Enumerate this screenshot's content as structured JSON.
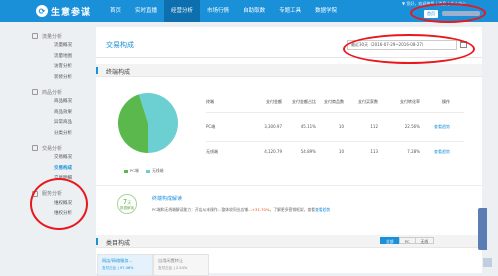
{
  "app": {
    "logo_text": "生意参谋"
  },
  "nav": [
    {
      "label": "首页",
      "active": false
    },
    {
      "label": "实时直播",
      "active": false
    },
    {
      "label": "经营分析",
      "active": true
    },
    {
      "label": "市场行情",
      "active": false
    },
    {
      "label": "自助取数",
      "active": false
    },
    {
      "label": "专题工具",
      "active": false
    },
    {
      "label": "数据学院",
      "active": false
    }
  ],
  "user_bar": {
    "text": "▼ 您好，欢迎使用  |  消息  |  个人中心"
  },
  "shop_button": "首页",
  "sidebar": {
    "sections": [
      {
        "title": "流量分析",
        "items": [
          "流量概况",
          "流量地图",
          "访客分析",
          "装修分析"
        ]
      },
      {
        "title": "商品分析",
        "items": [
          "商品概况",
          "商品效果",
          "异常商品",
          "分类分析"
        ]
      },
      {
        "title": "交易分析",
        "items": [
          "交易概况",
          "交易构成",
          "交易明细"
        ]
      },
      {
        "title": "服务分析",
        "items": [
          "维权概况",
          "维权分析"
        ]
      }
    ],
    "active_item": "交易构成"
  },
  "main": {
    "title": "交易构成",
    "date_range": "最近30天（2016-07-29~2016-08-27）",
    "terminal_section": {
      "title": "终端构成",
      "legend": [
        {
          "label": "PC端",
          "color": "#5ab84d"
        },
        {
          "label": "无线端",
          "color": "#6ccfd1"
        }
      ],
      "table": {
        "headers": [
          "终端",
          "支付金额",
          "支付金额占比",
          "支付商品数",
          "支付买家数",
          "支付转化率",
          "操作"
        ],
        "rows": [
          [
            "PC端",
            "3,300.97",
            "45.11%",
            "10",
            "112",
            "22.56%",
            "查看趋势"
          ],
          [
            "无线端",
            "4,120.79",
            "54.89%",
            "10",
            "113",
            "7.28%",
            "查看趋势"
          ]
        ]
      },
      "pie": {
        "pc_share": 45.11,
        "wireless_share": 54.89
      }
    },
    "interpretation": {
      "days_number": "7",
      "days_unit": "天",
      "days_caption": "数据解读",
      "title": "终端构成解读",
      "text_prefix": "PC端和无线端解读能力：开店从未操作…整体较同业店铺…",
      "text_pct": "+31.70%",
      "text_suffix": "，了解更多营销框架，查看",
      "text_link": "查看趋势"
    },
    "category_section": {
      "title": "类目构成",
      "tabs": [
        {
          "label": "全部",
          "active": true
        },
        {
          "label": "PC",
          "active": false
        },
        {
          "label": "无线",
          "active": false
        }
      ],
      "categories": [
        {
          "name": "网店/网络服务…",
          "share": "支付占比 | 97.46%",
          "active": true
        },
        {
          "name": "自用闲置转让",
          "share": "支付占比 | 2.54%",
          "active": false
        }
      ]
    }
  },
  "colors": {
    "brand": "#1a90d8",
    "nav_active": "#0d6fae",
    "pie_pc": "#5ab84d",
    "pie_wireless": "#6ccfd1",
    "annotation": "#e8181e"
  }
}
